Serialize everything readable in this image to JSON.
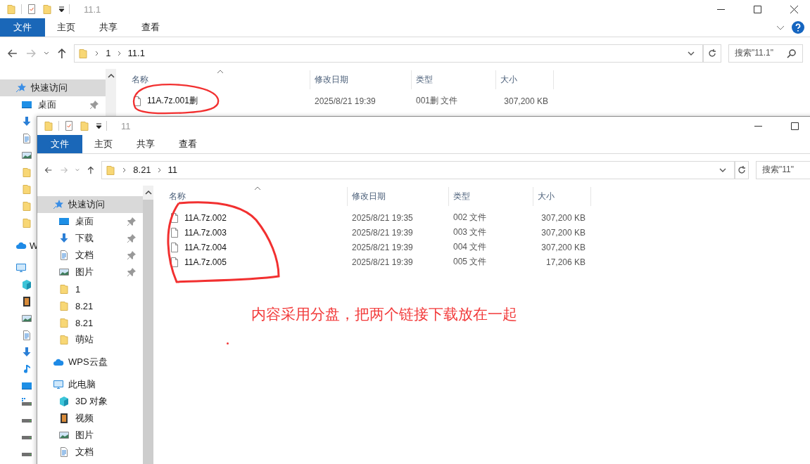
{
  "back_window": {
    "title": "11.1",
    "ribbon_tabs": [
      {
        "label": "文件",
        "selected": true
      },
      {
        "label": "主页",
        "selected": false
      },
      {
        "label": "共享",
        "selected": false
      },
      {
        "label": "查看",
        "selected": false
      }
    ],
    "path": [
      "1",
      "11.1"
    ],
    "search": {
      "placeholder": "搜索\"11.1\""
    },
    "sidebar": [
      {
        "label": "快速访问",
        "kind": "quick",
        "selected": true,
        "pinned": false
      },
      {
        "label": "桌面",
        "kind": "desktop",
        "selected": false,
        "pinned": true
      }
    ],
    "sidebar_cut_rows": [
      {
        "kind": "download"
      },
      {
        "kind": "documents"
      },
      {
        "kind": "pictures"
      },
      {
        "kind": "folder"
      },
      {
        "kind": "folder"
      },
      {
        "kind": "folder"
      },
      {
        "kind": "folder"
      },
      {
        "kind": "cloud",
        "label": "W"
      },
      {
        "kind": "pc"
      },
      {
        "kind": "cube"
      },
      {
        "kind": "video"
      },
      {
        "kind": "pictures"
      },
      {
        "kind": "documents"
      },
      {
        "kind": "download"
      },
      {
        "kind": "music"
      },
      {
        "kind": "desktop"
      },
      {
        "kind": "winDrive"
      },
      {
        "kind": "drive"
      },
      {
        "kind": "drive"
      },
      {
        "kind": "drive"
      }
    ],
    "columns": [
      "名称",
      "修改日期",
      "类型",
      "大小"
    ],
    "rows": [
      {
        "name": "11A.7z.001删",
        "date": "2025/8/21 19:39",
        "type": "001删 文件",
        "size": "307,200 KB"
      }
    ]
  },
  "front_window": {
    "title": "11",
    "ribbon_tabs": [
      {
        "label": "文件",
        "selected": true
      },
      {
        "label": "主页",
        "selected": false
      },
      {
        "label": "共享",
        "selected": false
      },
      {
        "label": "查看",
        "selected": false
      }
    ],
    "path": [
      "8.21",
      "11"
    ],
    "search": {
      "placeholder": "搜索\"11\""
    },
    "sidebar": [
      {
        "label": "快速访问",
        "kind": "quick",
        "selected": true,
        "pinned": false
      },
      {
        "label": "桌面",
        "kind": "desktop",
        "selected": false,
        "pinned": true
      },
      {
        "label": "下载",
        "kind": "download",
        "selected": false,
        "pinned": true
      },
      {
        "label": "文档",
        "kind": "documents",
        "selected": false,
        "pinned": true
      },
      {
        "label": "图片",
        "kind": "pictures",
        "selected": false,
        "pinned": true
      },
      {
        "label": "1",
        "kind": "folder",
        "selected": false,
        "pinned": false
      },
      {
        "label": "8.21",
        "kind": "folder",
        "selected": false,
        "pinned": false
      },
      {
        "label": "8.21",
        "kind": "folder",
        "selected": false,
        "pinned": false
      },
      {
        "label": "萌站",
        "kind": "folder",
        "selected": false,
        "pinned": false
      },
      {
        "label": "WPS云盘",
        "kind": "cloud",
        "selected": false,
        "pinned": false
      },
      {
        "label": "此电脑",
        "kind": "pc",
        "selected": false,
        "pinned": false
      },
      {
        "label": "3D 对象",
        "kind": "cube",
        "selected": false,
        "pinned": false
      },
      {
        "label": "视频",
        "kind": "video",
        "selected": false,
        "pinned": false
      },
      {
        "label": "图片",
        "kind": "pictures",
        "selected": false,
        "pinned": false
      },
      {
        "label": "文档",
        "kind": "documents",
        "selected": false,
        "pinned": false
      }
    ],
    "columns": [
      "名称",
      "修改日期",
      "类型",
      "大小"
    ],
    "rows": [
      {
        "name": "11A.7z.002",
        "date": "2025/8/21 19:35",
        "type": "002 文件",
        "size": "307,200 KB"
      },
      {
        "name": "11A.7z.003",
        "date": "2025/8/21 19:39",
        "type": "003 文件",
        "size": "307,200 KB"
      },
      {
        "name": "11A.7z.004",
        "date": "2025/8/21 19:39",
        "type": "004 文件",
        "size": "307,200 KB"
      },
      {
        "name": "11A.7z.005",
        "date": "2025/8/21 19:39",
        "type": "005 文件",
        "size": "17,206 KB"
      }
    ]
  },
  "annotation": {
    "note": "内容采用分盘，把两个链接下载放在一起"
  }
}
